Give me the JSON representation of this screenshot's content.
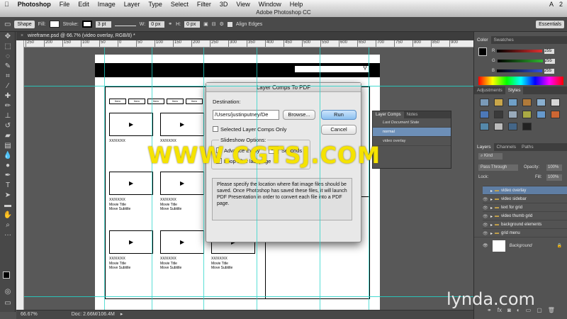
{
  "menubar": {
    "app": "Photoshop",
    "items": [
      "File",
      "Edit",
      "Image",
      "Layer",
      "Type",
      "Select",
      "Filter",
      "3D",
      "View",
      "Window",
      "Help"
    ],
    "right": [
      "A",
      "2"
    ]
  },
  "window_title": "Adobe Photoshop CC",
  "options": {
    "tool_mode": "Shape",
    "fill_label": "Fill:",
    "stroke_label": "Stroke:",
    "stroke_width": "3 pt",
    "w_label": "W:",
    "w_value": "0 px",
    "h_label": "H:",
    "h_value": "0 px",
    "align_edges": "Align Edges",
    "workspace": "Essentials"
  },
  "doc_tab": {
    "close": "×",
    "title": "wireframe.psd @ 66.7% (video overlay, RGB/8) *"
  },
  "ruler_ticks": [
    "250",
    "200",
    "150",
    "100",
    "50",
    "0",
    "50",
    "100",
    "150",
    "200",
    "250",
    "300",
    "350",
    "400",
    "450",
    "500",
    "550",
    "600",
    "650",
    "700",
    "750",
    "800",
    "850",
    "900"
  ],
  "wireframe": {
    "nav_tabs": [
      "Item",
      "Item",
      "Item",
      "Item",
      "Item"
    ],
    "captions": [
      {
        "date": "XX/XX/XX",
        "title": "Movie Title\nMove Subtitle"
      },
      {
        "date": "XX/XX/XX",
        "title": "Movie Title\nMove Subtitle"
      },
      {
        "date": "XX/XX/XX",
        "title": "Movie Title\nMove Subtitle"
      },
      {
        "date": "XX/XX/XX",
        "title": "Movie Title\nMove Subtitle"
      },
      {
        "date": "XX/XX/XX",
        "title": "Movie Title\nMove Subtitle"
      },
      {
        "date": "XX/XX/XX",
        "title": "Movie Title\nMove Subtitle"
      }
    ]
  },
  "status": {
    "zoom": "66.67%",
    "doc": "Doc: 2.66M/106.4M"
  },
  "color_panel": {
    "tabs": [
      "Color",
      "Swatches"
    ],
    "values": [
      "255",
      "255",
      "255"
    ],
    "colors": {
      "r": "#e23030",
      "g": "#2fb82f",
      "b": "#3050e0"
    }
  },
  "adjust_panel": {
    "tabs": [
      "Adjustments",
      "Styles"
    ]
  },
  "layers_panel": {
    "tabs": [
      "Layers",
      "Channels",
      "Paths"
    ],
    "kind": "Kind",
    "blend": "Pass Through",
    "opacity_label": "Opacity:",
    "opacity": "100%",
    "lock_label": "Lock:",
    "fill_label": "Fill:",
    "fill": "100%",
    "layers": [
      {
        "name": "video overlay",
        "selected": true
      },
      {
        "name": "video sidebar",
        "selected": false
      },
      {
        "name": "text for grid",
        "selected": false
      },
      {
        "name": "video thumb grid",
        "selected": false
      },
      {
        "name": "background elements",
        "selected": false
      },
      {
        "name": "grid menu",
        "selected": false
      }
    ],
    "background": "Background"
  },
  "layer_comps": {
    "tabs": [
      "Layer Comps",
      "Notes"
    ],
    "rows": [
      "Last Document State",
      "normal",
      "video overlay"
    ]
  },
  "dialog": {
    "title": "Layer Comps To PDF",
    "destination_label": "Destination:",
    "destination_value": "/Users/justinputney/De",
    "browse": "Browse...",
    "run": "Run",
    "cancel": "Cancel",
    "selected_only": "Selected Layer Comps Only",
    "slideshow_label": "Slideshow Options:",
    "advance_every": "Advance Every",
    "advance_value": "5",
    "seconds": "Seconds",
    "loop": "Loop after last page",
    "info": "Please specify the location where flat image files should be saved. Once Photoshop has saved these files, it will launch PDF Presentation in order to convert each file into a PDF page."
  },
  "watermark": "WWW.CGTSJ.COM",
  "brand": "lynda.com"
}
